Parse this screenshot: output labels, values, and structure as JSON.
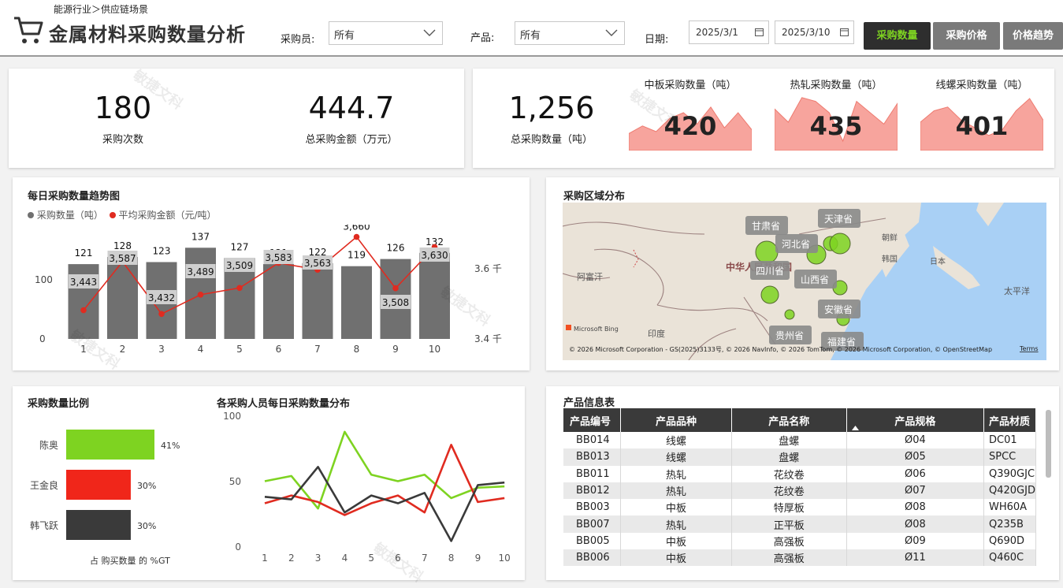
{
  "header": {
    "breadcrumb": "能源行业＞供应链场景",
    "title": "金属材料采购数量分析",
    "filters": {
      "buyer_label": "采购员:",
      "buyer_value": "所有",
      "product_label": "产品:",
      "product_value": "所有",
      "date_label": "日期:",
      "date_start": "2025/3/1",
      "date_end": "2025/3/10"
    },
    "buttons": [
      "采购数量",
      "采购价格",
      "价格趋势"
    ],
    "active_button_color": "#7ed321"
  },
  "kpis": {
    "count_value": "180",
    "count_label": "采购次数",
    "amount_value": "444.7",
    "amount_label": "总采购金额（万元）",
    "total_value": "1,256",
    "total_label": "总采购数量（吨）",
    "minis": [
      {
        "title": "中板采购数量（吨）",
        "value": "420"
      },
      {
        "title": "热轧采购数量（吨）",
        "value": "435"
      },
      {
        "title": "线螺采购数量（吨）",
        "value": "401"
      }
    ]
  },
  "trend": {
    "title": "每日采购数量趋势图",
    "legend": [
      {
        "label": "采购数量（吨）",
        "color": "#707070"
      },
      {
        "label": "平均采购金额（元/吨）",
        "color": "#e02b20"
      }
    ],
    "left_ticks": [
      "100",
      "0"
    ],
    "right_ticks": [
      "3.6 千",
      "3.4 千"
    ]
  },
  "map": {
    "title": "采购区域分布",
    "labels": [
      "甘肃省",
      "天津省",
      "河北省",
      "四川省",
      "山西省",
      "安徽省",
      "贵州省",
      "福建省"
    ],
    "place_names": [
      "中华人民共和国",
      "阿富汗",
      "印度",
      "朝鲜",
      "韩国",
      "日本",
      "太平洋"
    ],
    "logo": "Microsoft Bing",
    "attribution": "© 2026 Microsoft Corporation - GS(2025)3133号, © 2026 NavInfo, © 2026 TomTom, © 2026 Microsoft Corporation, © OpenStreetMap",
    "terms": "Terms"
  },
  "ratio": {
    "title": "采购数量比例",
    "footer": "占 购买数量 的 %GT"
  },
  "lines": {
    "title": "各采购人员每日采购数量分布",
    "y_ticks": [
      "100",
      "50",
      "0"
    ]
  },
  "table": {
    "title": "产品信息表",
    "columns": [
      "产品编号",
      "产品品种",
      "产品名称",
      "产品规格",
      "产品材质"
    ],
    "rows": [
      [
        "BB014",
        "线螺",
        "盘螺",
        "Ø04",
        "DC01"
      ],
      [
        "BB013",
        "线螺",
        "盘螺",
        "Ø05",
        "SPCC"
      ],
      [
        "BB011",
        "热轧",
        "花纹卷",
        "Ø06",
        "Q390GJC"
      ],
      [
        "BB012",
        "热轧",
        "花纹卷",
        "Ø07",
        "Q420GJD"
      ],
      [
        "BB003",
        "中板",
        "特厚板",
        "Ø08",
        "WH60A"
      ],
      [
        "BB007",
        "热轧",
        "正平板",
        "Ø08",
        "Q235B"
      ],
      [
        "BB005",
        "中板",
        "高强板",
        "Ø09",
        "Q690D"
      ],
      [
        "BB006",
        "中板",
        "高强板",
        "Ø11",
        "Q460C"
      ]
    ]
  },
  "watermark": "敏捷文科",
  "chart_data": [
    {
      "type": "bar",
      "title": "每日采购数量趋势图",
      "categories": [
        "1",
        "2",
        "3",
        "4",
        "5",
        "6",
        "7",
        "8",
        "9",
        "10"
      ],
      "series": [
        {
          "name": "采购数量（吨）",
          "values": [
            121,
            128,
            123,
            137,
            127,
            121,
            122,
            119,
            126,
            132
          ]
        },
        {
          "name": "平均采购金额（元/吨）",
          "values": [
            3443,
            3587,
            3432,
            3489,
            3509,
            3583,
            3563,
            3660,
            3508,
            3630
          ]
        }
      ],
      "ylim": [
        0,
        140
      ],
      "y2lim": [
        3400,
        3670
      ]
    },
    {
      "type": "area",
      "title": "中板采购数量（吨）",
      "values": [
        18,
        26,
        20,
        34,
        40,
        28,
        46,
        24,
        40,
        22
      ]
    },
    {
      "type": "area",
      "title": "热轧采购数量（吨）",
      "values": [
        44,
        30,
        56,
        52,
        40,
        10,
        52,
        40,
        28,
        50
      ]
    },
    {
      "type": "area",
      "title": "线螺采购数量（吨）",
      "values": [
        30,
        42,
        46,
        32,
        24,
        16,
        22,
        42,
        55,
        32
      ]
    },
    {
      "type": "bar",
      "title": "采购数量比例",
      "categories": [
        "陈奥",
        "王金良",
        "韩飞跃"
      ],
      "values": [
        41,
        30,
        30
      ],
      "labels": [
        "41%",
        "30%",
        "30%"
      ],
      "colors": [
        "#7ed321",
        "#f0261a",
        "#3a3a3a"
      ]
    },
    {
      "type": "line",
      "title": "各采购人员每日采购数量分布",
      "x": [
        1,
        2,
        3,
        4,
        5,
        6,
        7,
        8,
        9,
        10
      ],
      "ylim": [
        0,
        100
      ],
      "series": [
        {
          "color": "#7ed321",
          "values": [
            50,
            54,
            29,
            88,
            55,
            50,
            55,
            37,
            45,
            46
          ]
        },
        {
          "color": "#e02b20",
          "values": [
            33,
            39,
            34,
            24,
            33,
            39,
            26,
            78,
            34,
            37
          ]
        },
        {
          "color": "#3a3a3a",
          "values": [
            38,
            36,
            61,
            26,
            39,
            33,
            41,
            4,
            47,
            49
          ]
        }
      ]
    }
  ]
}
